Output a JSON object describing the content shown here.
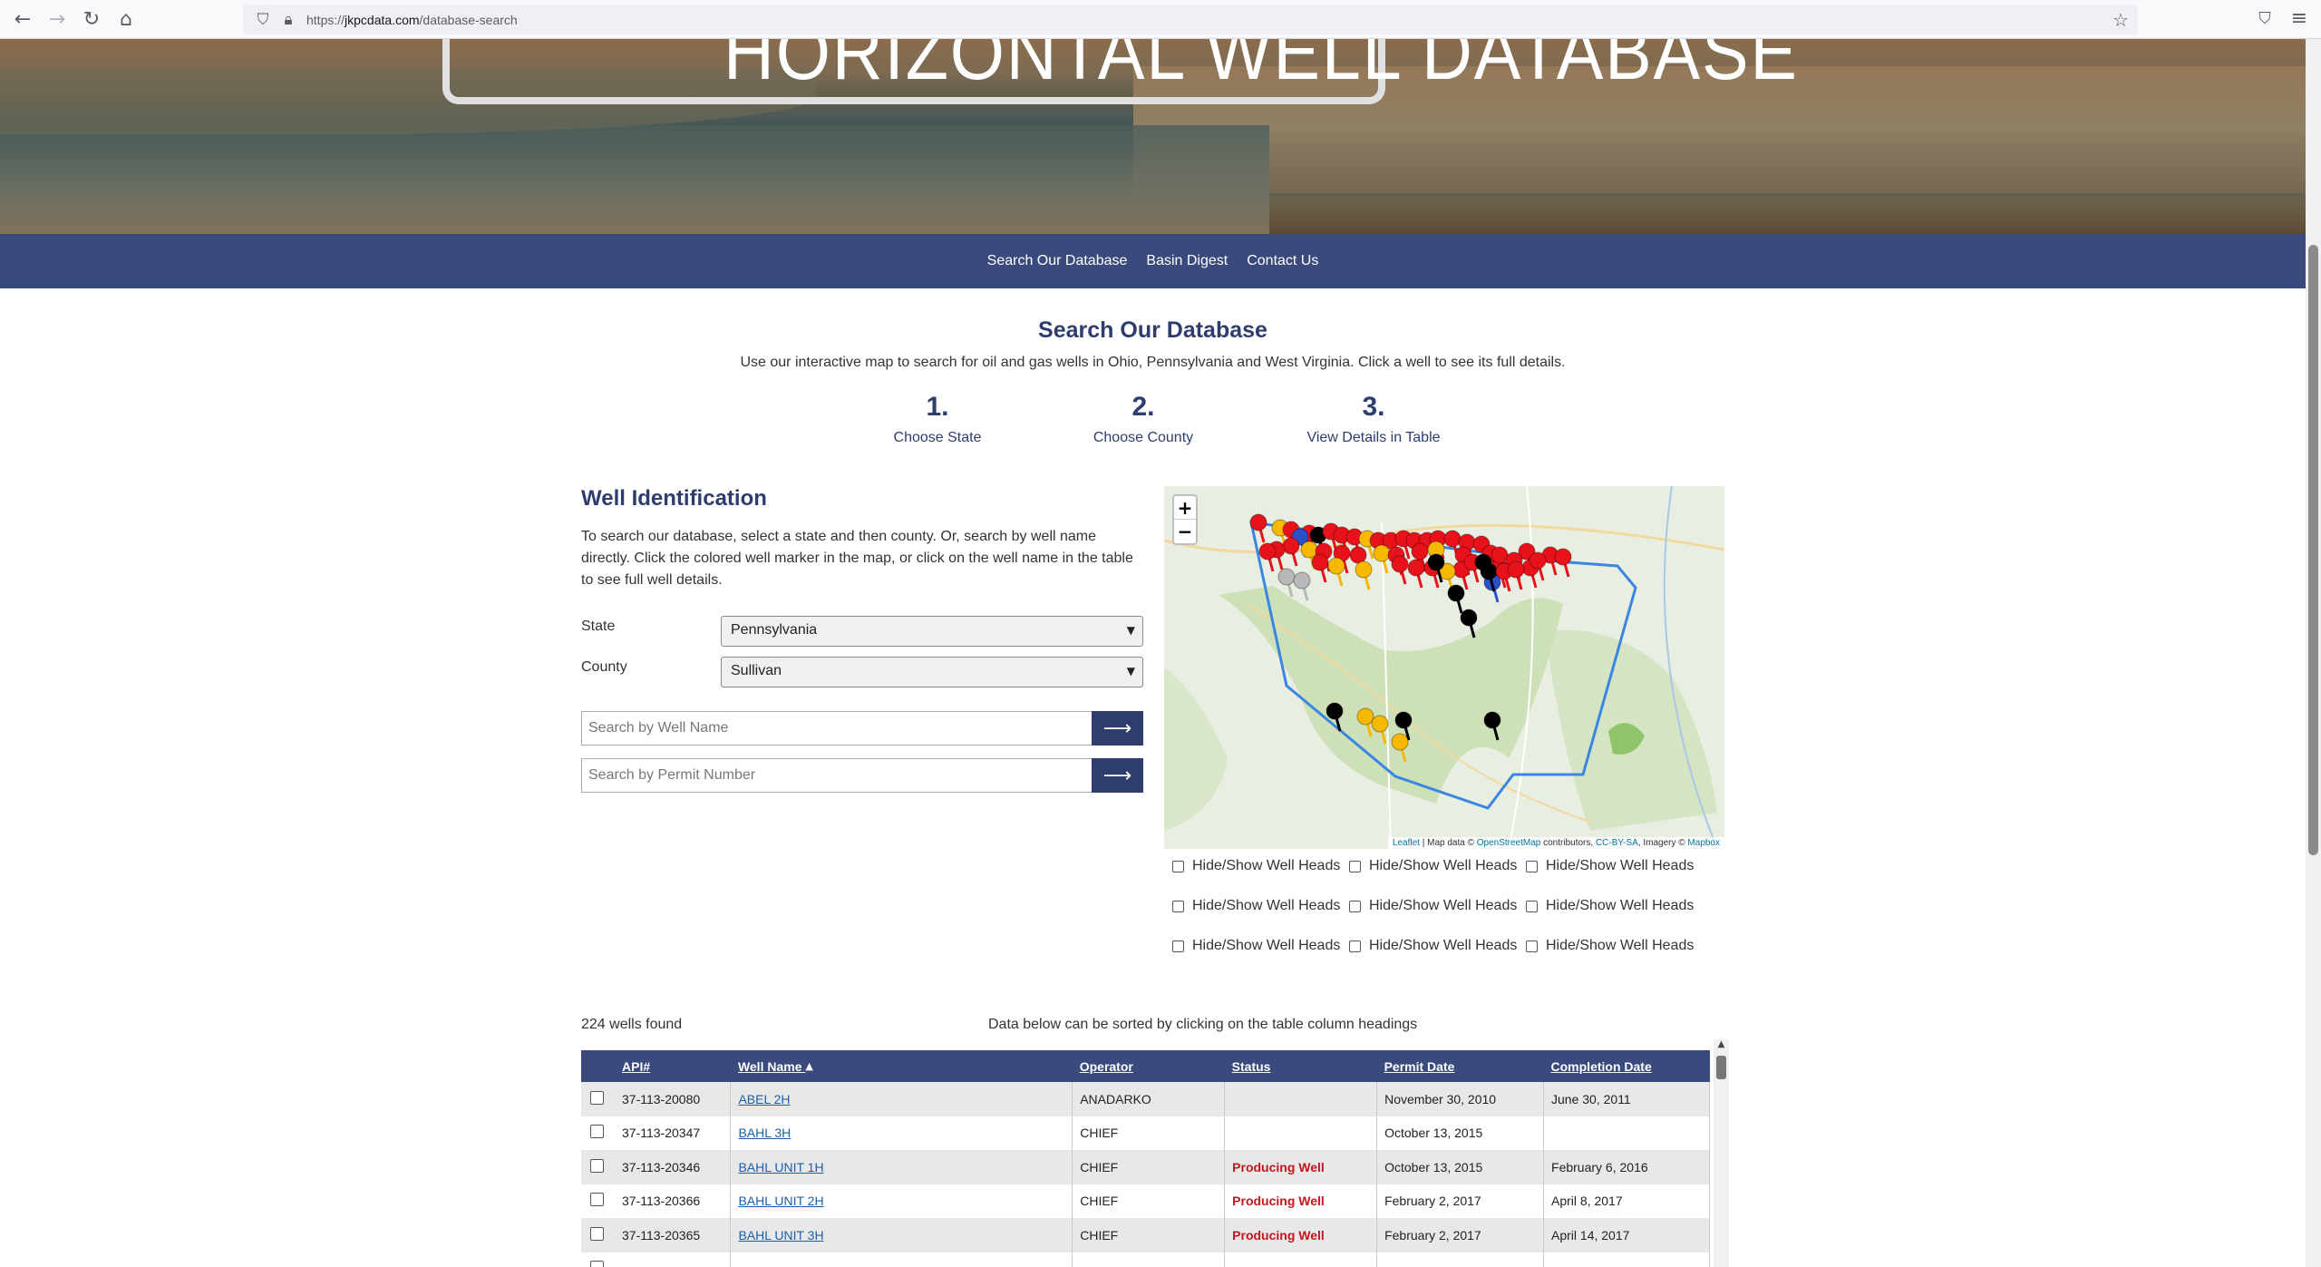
{
  "browser": {
    "url_prefix": "https://",
    "url_domain": "jkpcdata.com",
    "url_path": "/database-search"
  },
  "hero": {
    "title_left": "HORIZONTAL WELL",
    "title_right": "DATABASE"
  },
  "nav": {
    "items": [
      "Search Our Database",
      "Basin Digest",
      "Contact Us"
    ]
  },
  "intro": {
    "title": "Search Our Database",
    "subtitle": "Use our interactive map to search for oil and gas wells in Ohio, Pennsylvania and West Virginia. Click a well to see its full details.",
    "steps": [
      {
        "num": "1.",
        "label": "Choose State"
      },
      {
        "num": "2.",
        "label": "Choose County"
      },
      {
        "num": "3.",
        "label": "View Details in Table"
      }
    ]
  },
  "well_id": {
    "heading": "Well Identification",
    "description": "To search our database, select a state and then county. Or, search by well name directly. Click the colored well marker in the map, or click on the well name in the table to see full well details.",
    "state_label": "State",
    "state_value": "Pennsylvania",
    "county_label": "County",
    "county_value": "Sullivan",
    "well_name_placeholder": "Search by Well Name",
    "permit_placeholder": "Search by Permit Number",
    "go_arrow": "⟶"
  },
  "map": {
    "zoom_in": "+",
    "zoom_out": "−",
    "attribution_leaflet": "Leaflet",
    "attribution_mid": " | Map data © ",
    "attribution_osm": "OpenStreetMap",
    "attribution_contrib": " contributors, ",
    "attribution_cc": "CC-BY-SA",
    "attribution_imagery": ", Imagery © ",
    "attribution_mapbox": "Mapbox",
    "colors": {
      "producing": "#e8121a",
      "permitted": "#f6b800",
      "plugged": "#000000",
      "other": "#2a4fc8",
      "inactive": "#b8b8b8",
      "boundary": "#3b86e0"
    }
  },
  "toggles": {
    "label": "Hide/Show Well Heads",
    "count": 9
  },
  "results": {
    "count_text": "224 wells found",
    "sort_note": "Data below can be sorted by clicking on the table column headings",
    "columns": [
      "API#",
      "Well Name",
      "Operator",
      "Status",
      "Permit Date",
      "Completion Date"
    ],
    "sort_indicator": "▲",
    "rows": [
      {
        "api": "37-113-20080",
        "name": "ABEL 2H",
        "operator": "ANADARKO",
        "status": "",
        "permit": "November 30, 2010",
        "completion": "June 30, 2011"
      },
      {
        "api": "37-113-20347",
        "name": "BAHL 3H",
        "operator": "CHIEF",
        "status": "",
        "permit": "October 13, 2015",
        "completion": ""
      },
      {
        "api": "37-113-20346",
        "name": "BAHL UNIT 1H",
        "operator": "CHIEF",
        "status": "Producing Well",
        "permit": "October 13, 2015",
        "completion": "February 6, 2016"
      },
      {
        "api": "37-113-20366",
        "name": "BAHL UNIT 2H",
        "operator": "CHIEF",
        "status": "Producing Well",
        "permit": "February 2, 2017",
        "completion": "April 8, 2017"
      },
      {
        "api": "37-113-20365",
        "name": "BAHL UNIT 3H",
        "operator": "CHIEF",
        "status": "Producing Well",
        "permit": "February 2, 2017",
        "completion": "April 14, 2017"
      },
      {
        "api": "",
        "name": "",
        "operator": "",
        "status": "",
        "permit": "",
        "completion": ""
      }
    ]
  }
}
